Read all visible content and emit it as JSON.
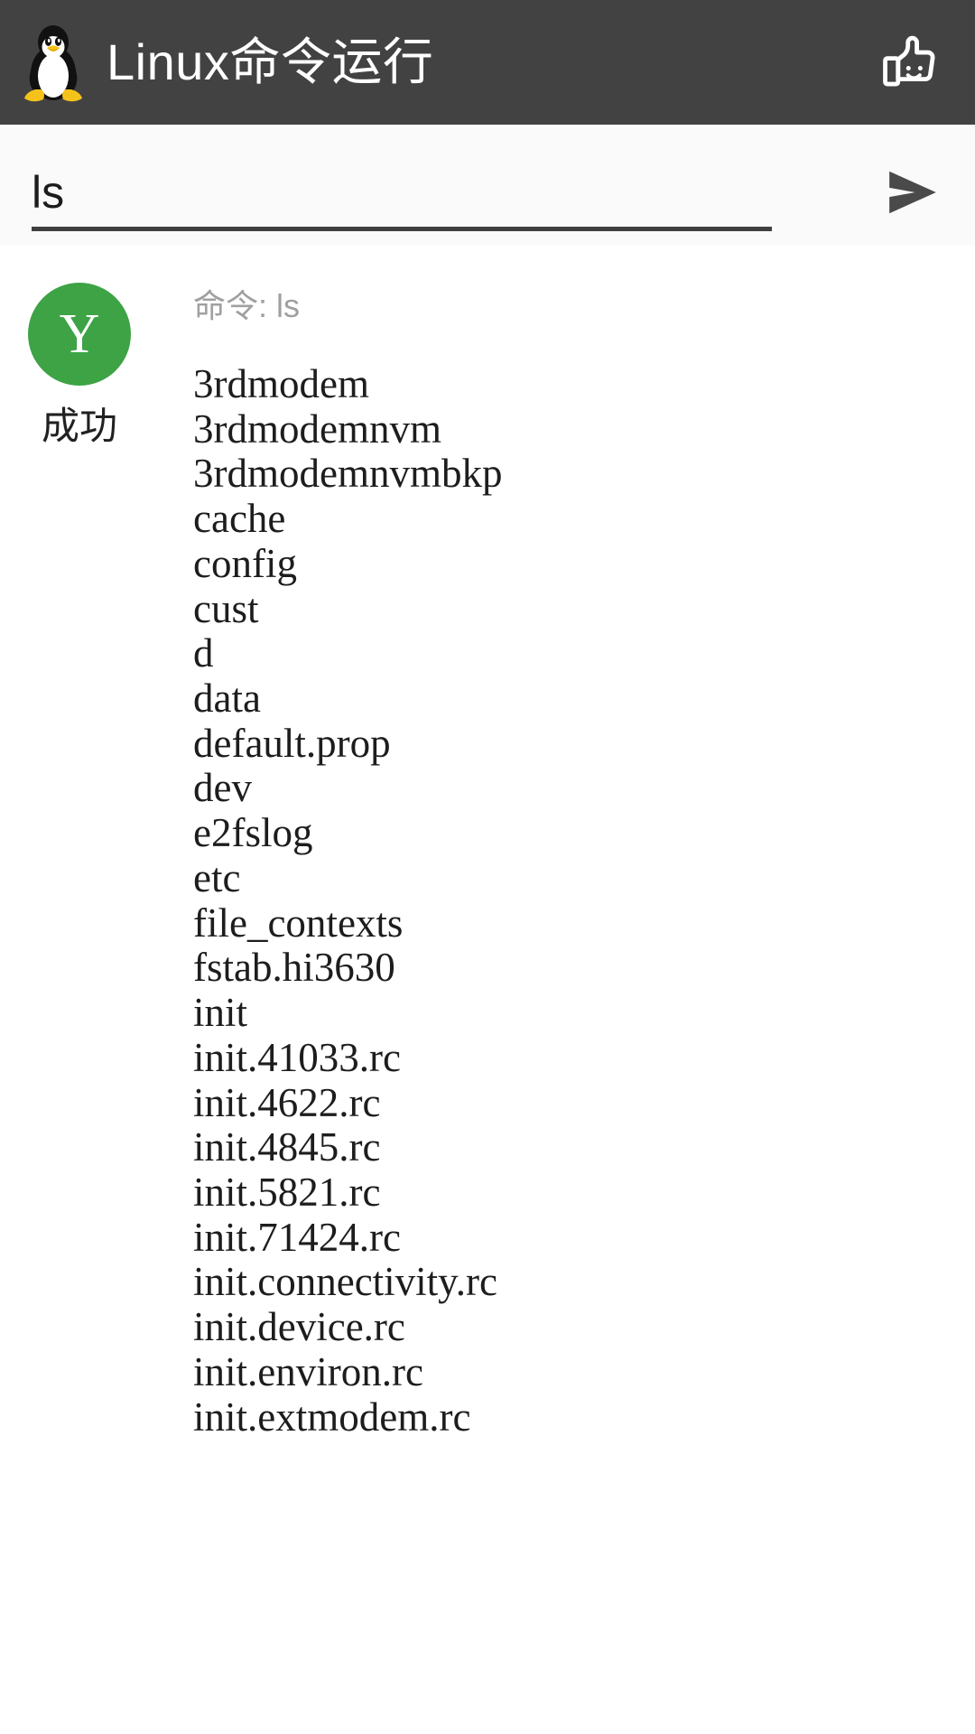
{
  "header": {
    "title": "Linux命令运行",
    "logo_icon": "tux-penguin-icon",
    "action_icon": "thumbs-up-icon",
    "background": "#424242",
    "text_color": "#ffffff"
  },
  "command_bar": {
    "value": "ls",
    "placeholder": "",
    "send_icon": "send-arrow-icon",
    "underline_color": "#3f3f3f",
    "background": "#fafafa"
  },
  "result": {
    "status_letter": "Y",
    "status_label": "成功",
    "status_color": "#3da345",
    "echo_prefix": "命令: ",
    "echo_command": "ls",
    "echo_color": "#a0a0a0",
    "output_lines": [
      "3rdmodem",
      "3rdmodemnvm",
      "3rdmodemnvmbkp",
      "cache",
      "config",
      "cust",
      "d",
      "data",
      "default.prop",
      "dev",
      "e2fslog",
      "etc",
      "file_contexts",
      "fstab.hi3630",
      "init",
      "init.41033.rc",
      "init.4622.rc",
      "init.4845.rc",
      "init.5821.rc",
      "init.71424.rc",
      "init.connectivity.rc",
      "init.device.rc",
      "init.environ.rc",
      "init.extmodem.rc"
    ]
  }
}
